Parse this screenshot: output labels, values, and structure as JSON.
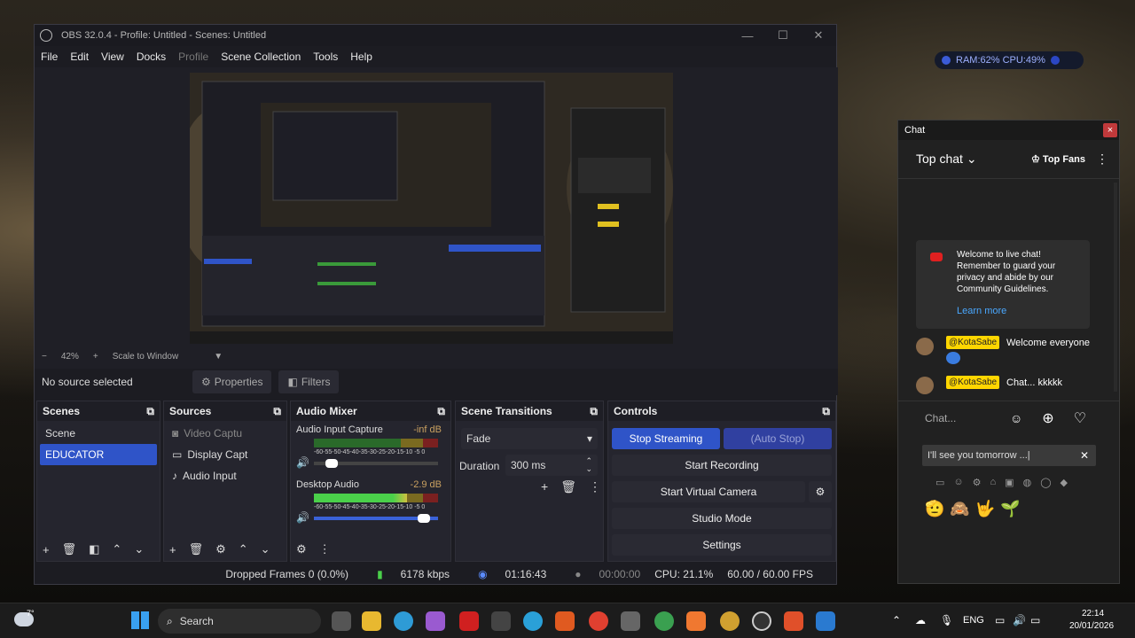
{
  "obs": {
    "title": "OBS 32.0.4 - Profile: Untitled - Scenes: Untitled",
    "menu": [
      "File",
      "Edit",
      "View",
      "Docks",
      "Profile",
      "Scene Collection",
      "Tools",
      "Help"
    ],
    "zoom": {
      "minus": "−",
      "percent": "42%",
      "plus": "+",
      "mode": "Scale to Window",
      "arrow": "▼"
    },
    "no_source": "No source selected",
    "properties_label": "Properties",
    "filters_label": "Filters",
    "scenes": {
      "title": "Scenes",
      "items": [
        "Scene",
        "EDUCATOR"
      ]
    },
    "sources": {
      "title": "Sources",
      "items": [
        "Video Captu",
        "Display Capt",
        "Audio Input"
      ]
    },
    "mixer": {
      "title": "Audio Mixer",
      "tracks": [
        {
          "name": "Audio Input Capture",
          "db": "-inf dB",
          "level": 0.0,
          "volume": 0.1
        },
        {
          "name": "Desktop Audio",
          "db": "-2.9 dB",
          "level": 0.75,
          "volume": 0.93
        }
      ],
      "scale": "-60-55-50-45-40-35-30-25-20-15-10 -5 0"
    },
    "transitions": {
      "title": "Scene Transitions",
      "selected": "Fade",
      "duration_label": "Duration",
      "duration_value": "300 ms"
    },
    "controls": {
      "title": "Controls",
      "stop_streaming": "Stop Streaming",
      "auto_stop": "(Auto Stop)",
      "start_recording": "Start Recording",
      "virtual_camera": "Start Virtual Camera",
      "studio_mode": "Studio Mode",
      "settings": "Settings"
    },
    "status": {
      "dropped": "Dropped Frames 0 (0.0%)",
      "bitrate": "6178 kbps",
      "stream_time": "01:16:43",
      "rec_time": "00:00:00",
      "cpu": "CPU: 21.1%",
      "fps": "60.00 / 60.00 FPS"
    }
  },
  "overlay": {
    "stats": "RAM:62% CPU:49%"
  },
  "chat": {
    "window_title": "Chat",
    "close": "×",
    "mode": "Top chat",
    "top_fans": "Top Fans",
    "welcome": "Welcome to live chat! Remember to guard your privacy and abide by our Community Guidelines.",
    "learn_more": "Learn more",
    "messages": [
      {
        "user": "@KotaSabe",
        "text": "Welcome everyone"
      },
      {
        "user": "@KotaSabe",
        "text": "Chat... kkkkk"
      }
    ],
    "input_placeholder": "Chat...",
    "draft": "I'll see you tomorrow ...|",
    "emojis": [
      "🫡",
      "🙈",
      "🤟",
      "🌱"
    ]
  },
  "taskbar": {
    "search": "Search",
    "lang": "ENG",
    "time": "22:14",
    "date": "20/01/2026",
    "weather": "7°"
  }
}
